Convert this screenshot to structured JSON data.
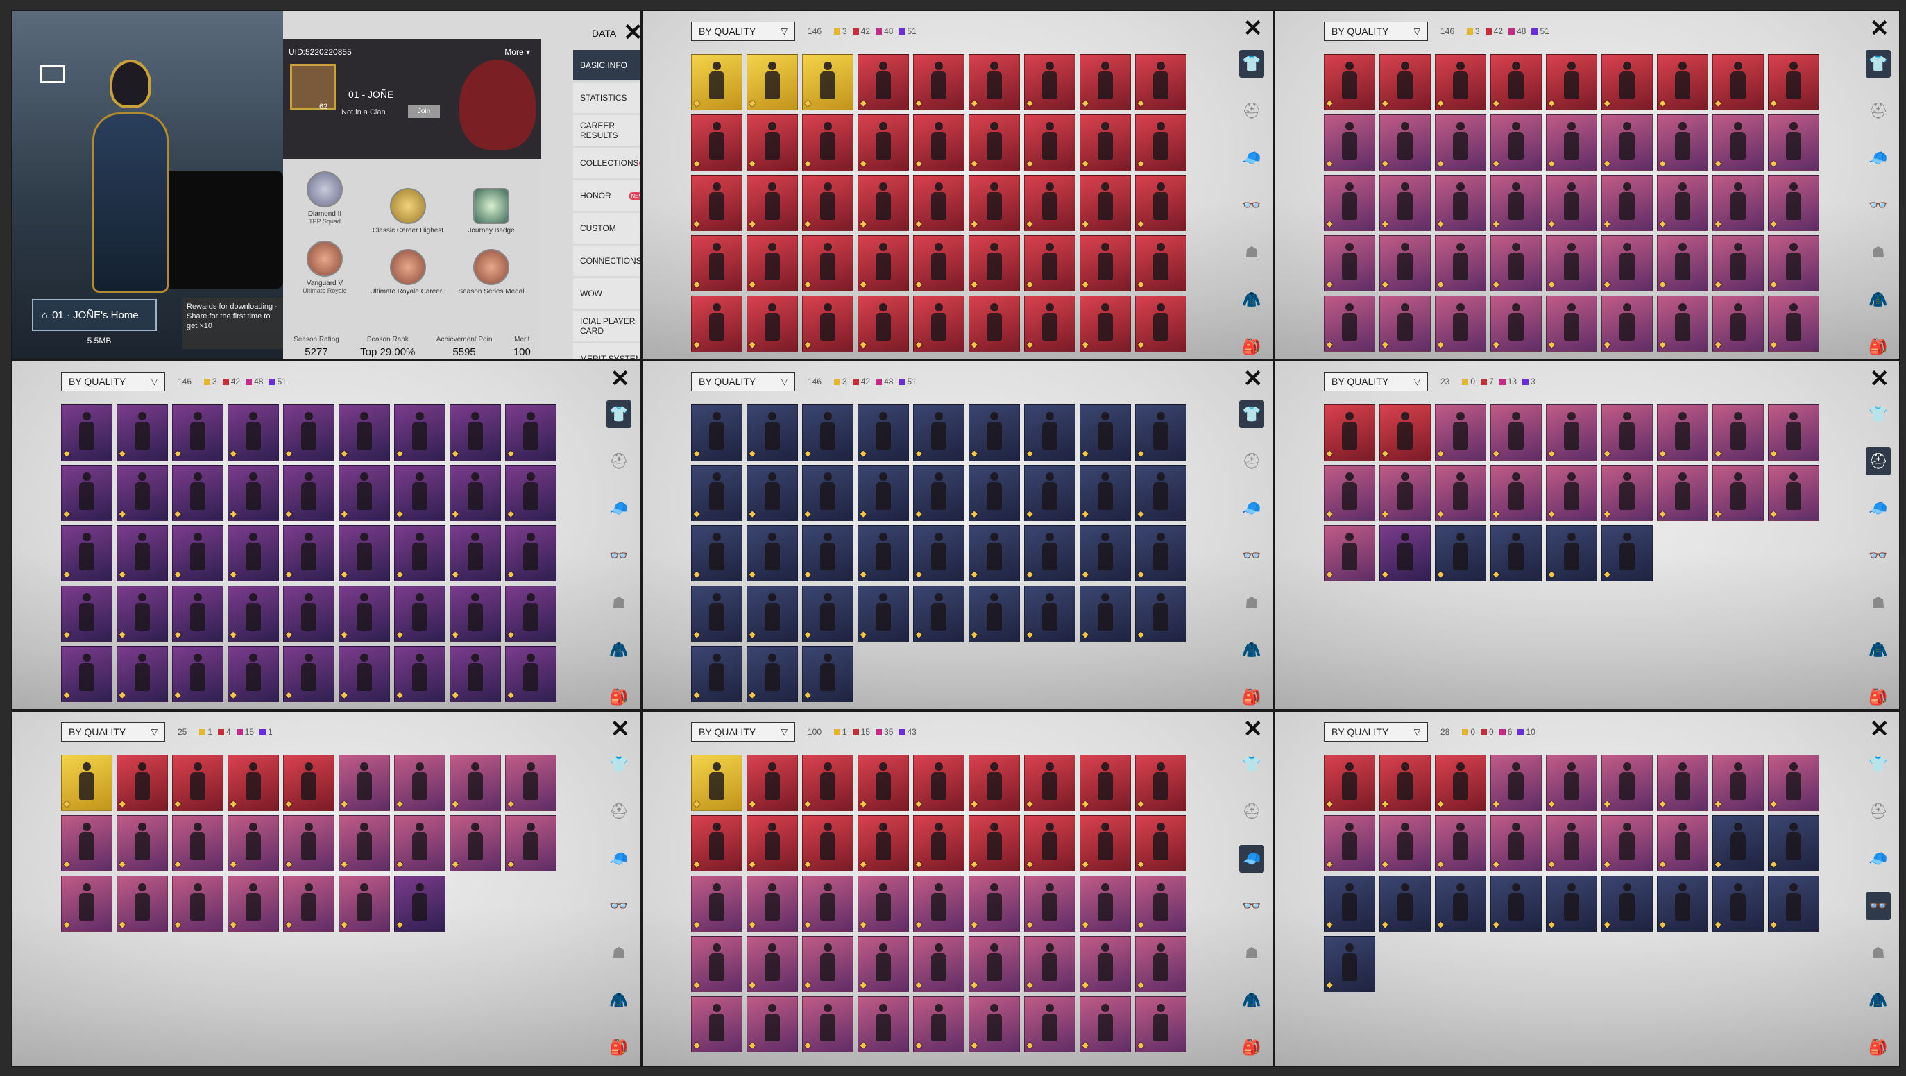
{
  "profile": {
    "uid": "UID:5220220855",
    "more": "More",
    "player_name": "01 - JOÑE",
    "avatar_level": "62",
    "clan": "Not in a Clan",
    "join": "Join",
    "home": "01 · JOÑE's Home",
    "home_size": "5.5MB",
    "reward_tip": "Rewards for downloading · Share for the first time to get ×10",
    "badges": [
      {
        "title": "Diamond II",
        "sub": "TPP Squad"
      },
      {
        "title": "Classic Career Highest",
        "sub": ""
      },
      {
        "title": "Journey Badge",
        "sub": ""
      },
      {
        "title": "Vanguard V",
        "sub": "Ultimate Royale"
      },
      {
        "title": "Ultimate Royale Career I",
        "sub": ""
      },
      {
        "title": "Season Series Medal",
        "sub": ""
      }
    ],
    "stats": [
      {
        "label": "Season Rating",
        "value": "5277"
      },
      {
        "label": "Season Rank",
        "value": "Top 29.00%"
      },
      {
        "label": "Achievement Poin",
        "value": "5595"
      },
      {
        "label": "Merit",
        "value": "100"
      }
    ],
    "data_title": "DATA",
    "menu": [
      "BASIC INFO",
      "STATISTICS",
      "CAREER RESULTS",
      "COLLECTIONS",
      "HONOR",
      "CUSTOM",
      "CONNECTIONS",
      "WOW",
      "ICIAL PLAYER CARD",
      "MERIT SYSTEM"
    ],
    "new_badge": "NEW"
  },
  "inventory": {
    "filter_label": "BY QUALITY",
    "panels": [
      {
        "count": "146",
        "legend": [
          "3",
          "42",
          "48",
          "51"
        ],
        "tiles": "gggrrrrrrrrrrrrrrrrrrrrrrrrrrrrrrrrrrrrrrrrrrrrrrr",
        "active": 0
      },
      {
        "count": "146",
        "legend": [
          "3",
          "42",
          "48",
          "51"
        ],
        "tiles": "rrrrrrrrrppppppppppppppppppppppppppppppppppppp",
        "active": 0
      },
      {
        "count": "146",
        "legend": [
          "3",
          "42",
          "48",
          "51"
        ],
        "tiles": "uuuuuuuuuuuuuuuuuuuuuuuuuuuuuuuuuuuuuuuuuuuuu",
        "active": 0
      },
      {
        "count": "146",
        "legend": [
          "3",
          "42",
          "48",
          "51"
        ],
        "tiles": "bbbbbbbbbbbbbbbbbbbbbbbbbbbbbbbbbbbbbbb",
        "active": 0
      },
      {
        "count": "23",
        "legend": [
          "0",
          "7",
          "13",
          "3"
        ],
        "tiles": "rrpppppppppppppppppubbbb",
        "active": 1
      },
      {
        "count": "25",
        "legend": [
          "1",
          "4",
          "15",
          "1"
        ],
        "tiles": "grrrrpppppppppppppppppppu",
        "active": 7
      },
      {
        "count": "100",
        "legend": [
          "1",
          "15",
          "35",
          "43"
        ],
        "tiles": "grrrrrrrrrrrrrrrrrpppppppppppppppppppppppppppp",
        "active": 2
      },
      {
        "count": "28",
        "legend": [
          "0",
          "0",
          "6",
          "10"
        ],
        "tiles": "rrrpppppppppppppbbbbbbbbbbbb",
        "active": 3
      }
    ],
    "side_icons": [
      "outfit-icon",
      "helmet-icon",
      "hat-icon",
      "glasses-icon",
      "mask-icon",
      "jacket-icon",
      "backpack-icon"
    ],
    "colors": {
      "gold": "#e2b62f",
      "red": "#c22e3c",
      "pink": "#c12c86",
      "purple": "#6a2fd4",
      "blue": "#2c3566"
    }
  }
}
